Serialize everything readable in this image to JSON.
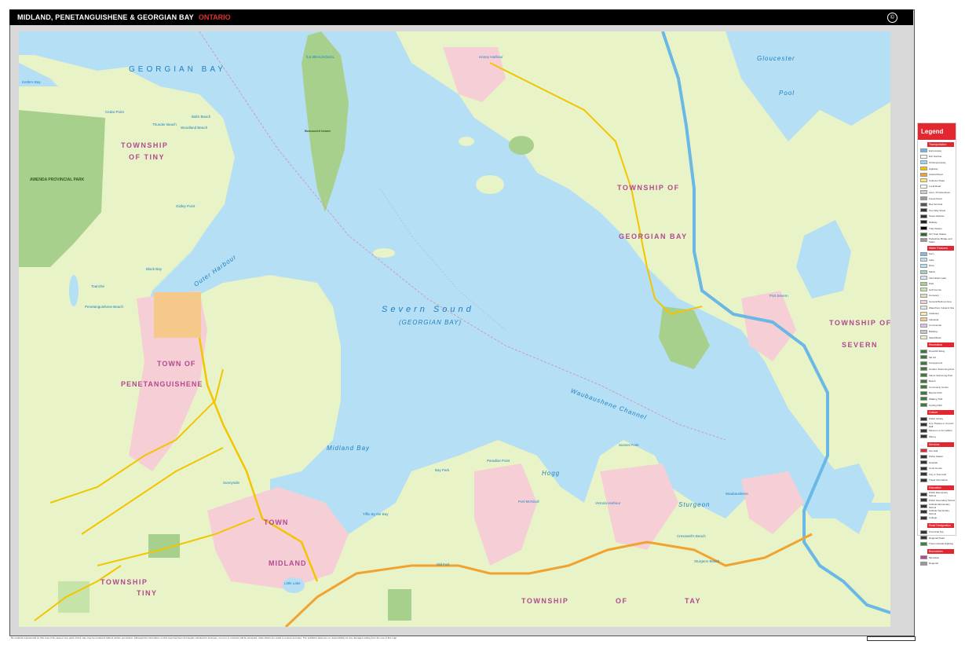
{
  "header": {
    "title": "MIDLAND, PENETANGUISHENE & GEORGIAN BAY",
    "subtitle": "ONTARIO",
    "logo_icon": "compass-badge-icon"
  },
  "colors": {
    "water": "#b5dff4",
    "land": "#e8f3c7",
    "park": "#a8d08d",
    "urban": "#f6cfd6",
    "highway": "#f2c500",
    "arterial": "#f0a330",
    "freeway": "#6ab8e6",
    "accent": "#e3262f",
    "township_label": "#b14a8f",
    "water_label": "#1e7fc2"
  },
  "map": {
    "large_water": [
      {
        "text": "GEORGIAN  BAY",
        "key": "georgian_bay"
      },
      {
        "text": "Severn  Sound",
        "key": "severn_sound"
      },
      {
        "text": "(GEORGIAN BAY)",
        "key": "severn_sub"
      }
    ],
    "townships": [
      "TOWNSHIP",
      "OF TINY",
      "TOWNSHIP OF",
      "GEORGIAN BAY",
      "TOWNSHIP OF",
      "SEVERN",
      "TOWN OF",
      "PENETANGUISHENE",
      "TOWN",
      "MIDLAND",
      "TOWNSHIP",
      "TINY",
      "TOWNSHIP",
      "OF",
      "TAY"
    ],
    "water_names": [
      "Kettle's Bay",
      "Outer Harbour",
      "Midland Bay",
      "Waubaushene Channel",
      "Hogg",
      "Sturgeon",
      "Gloucester",
      "Pool",
      "Little Lake",
      "Black Bay"
    ],
    "places": [
      "Port Severn",
      "Port McNicoll",
      "Victoria Harbour",
      "Waubaushene",
      "Honey Harbour",
      "ÎLE BEAUSOLEIL",
      "Gidley Point",
      "Sunset Point",
      "Cresswell's Beach",
      "Sturgeon Beach",
      "Old Fort",
      "Tiffin By the Bay",
      "Paradise Point",
      "Sunnyside",
      "Bay Park",
      "Thunder Beach",
      "Balm Beach",
      "Cedar Point",
      "Penetanguishene Beach",
      "Woodland Beach",
      "Toanche"
    ],
    "park_label": "AWENDA PROVINCIAL PARK",
    "island_label": "Beausoleil Island",
    "bay_label": "GEORGIAN BAY"
  },
  "legend": {
    "title": "Legend",
    "sections": [
      {
        "name": "Transportation",
        "items": [
          {
            "label": "Expressway",
            "color": "#6ab8e6"
          },
          {
            "label": "Exit Number",
            "color": "#ffffff"
          },
          {
            "label": "Toll Expressway",
            "color": "#9fd3ef"
          },
          {
            "label": "Highway",
            "color": "#f2c500"
          },
          {
            "label": "Arterial Road",
            "color": "#f0a330"
          },
          {
            "label": "Collector Road",
            "color": "#ffe66b"
          },
          {
            "label": "Local Road",
            "color": "#ffffff"
          },
          {
            "label": "Lane / Private Road",
            "color": "#cccccc"
          },
          {
            "label": "Forest Road",
            "color": "#999999"
          },
          {
            "label": "Bus Terminal",
            "color": "#555555"
          },
          {
            "label": "One Way Street",
            "color": "#333333"
          },
          {
            "label": "Street Address",
            "color": "#333333"
          },
          {
            "label": "Railway",
            "color": "#222222"
          },
          {
            "label": "Train Station",
            "color": "#000000"
          },
          {
            "label": "GO Train Station",
            "color": "#2f6b2f"
          },
          {
            "label": "Pedestrian Bridge and Stairs",
            "color": "#999999"
          }
        ]
      },
      {
        "name": "Water Features",
        "items": [
          {
            "label": "Ferry",
            "color": "#7dbbe0"
          },
          {
            "label": "Lake",
            "color": "#b5dff4"
          },
          {
            "label": "River",
            "color": "#b5dff4"
          },
          {
            "label": "Marsh",
            "color": "#9cd3c2"
          },
          {
            "label": "Intermittent Lake",
            "color": "#cfe9f5"
          },
          {
            "label": "Park",
            "color": "#a8d08d"
          },
          {
            "label": "Golf Course",
            "color": "#c6e3a8"
          },
          {
            "label": "Cemetery",
            "color": "#d1e7b9"
          },
          {
            "label": "General Built-up Area",
            "color": "#f6cfd6"
          },
          {
            "label": "Waterfront / Historic Site",
            "color": "#e6e6e6"
          },
          {
            "label": "Institution",
            "color": "#ffe7a8"
          },
          {
            "label": "Industrial",
            "color": "#f5c98a"
          },
          {
            "label": "Commercial",
            "color": "#d9c1e8"
          },
          {
            "label": "Building",
            "color": "#c6c6c6"
          },
          {
            "label": "Island/Rock",
            "color": "#e8f3c7"
          }
        ]
      },
      {
        "name": "Recreation",
        "items": [
          {
            "label": "Downhill Skiing",
            "color": "#3a7a3a"
          },
          {
            "label": "Ski Lift",
            "color": "#3a7a3a"
          },
          {
            "label": "Campground",
            "color": "#3a7a3a"
          },
          {
            "label": "Outdoor Swimming Pool",
            "color": "#3a7a3a"
          },
          {
            "label": "Indoor Swimming Pool",
            "color": "#3a7a3a"
          },
          {
            "label": "Beach",
            "color": "#3a7a3a"
          },
          {
            "label": "Community Centre",
            "color": "#3a7a3a"
          },
          {
            "label": "Bicycle Path",
            "color": "#3a7a3a"
          },
          {
            "label": "Walking Trail",
            "color": "#3a7a3a"
          },
          {
            "label": "Cycling Path",
            "color": "#3a7a3a"
          }
        ]
      },
      {
        "name": "Culture",
        "items": [
          {
            "label": "Public Library",
            "color": "#333333"
          },
          {
            "label": "Live Theatre or Concert Hall",
            "color": "#333333"
          },
          {
            "label": "Museum or Art Gallery",
            "color": "#333333"
          },
          {
            "label": "Winery",
            "color": "#333333"
          }
        ]
      },
      {
        "name": "Services",
        "items": [
          {
            "label": "Fire Hall",
            "color": "#e3262f"
          },
          {
            "label": "Police Station",
            "color": "#333333"
          },
          {
            "label": "Hospital",
            "color": "#333333"
          },
          {
            "label": "Court House",
            "color": "#333333"
          },
          {
            "label": "City or Town Hall",
            "color": "#333333"
          },
          {
            "label": "Travel Information",
            "color": "#333333"
          }
        ]
      },
      {
        "name": "Education",
        "items": [
          {
            "label": "Public Elementary School",
            "color": "#333333"
          },
          {
            "label": "Public Secondary School",
            "color": "#333333"
          },
          {
            "label": "Catholic Elementary School",
            "color": "#333333"
          },
          {
            "label": "Catholic Secondary School",
            "color": "#333333"
          },
          {
            "label": "College",
            "color": "#333333"
          }
        ]
      },
      {
        "name": "Road Designation",
        "items": [
          {
            "label": "Provincial Key",
            "color": "#333333"
          },
          {
            "label": "Regional Road",
            "color": "#333333"
          },
          {
            "label": "Trans-Canada Highway",
            "color": "#2f8a3f"
          }
        ]
      },
      {
        "name": "Boundaries",
        "items": [
          {
            "label": "Municipal",
            "color": "#b14a8f"
          },
          {
            "label": "Regional",
            "color": "#999999"
          }
        ]
      }
    ]
  },
  "footer": {
    "disclaimer": "No material represented on this map of the area or any parts of this map may be produced without written permission. Although the information on this map has been thoroughly checked for accuracy, no error or omission will be accepted, while efforts are made to ensure accuracy. The publisher assumes no responsibility for any damages arising from the use of this map."
  }
}
